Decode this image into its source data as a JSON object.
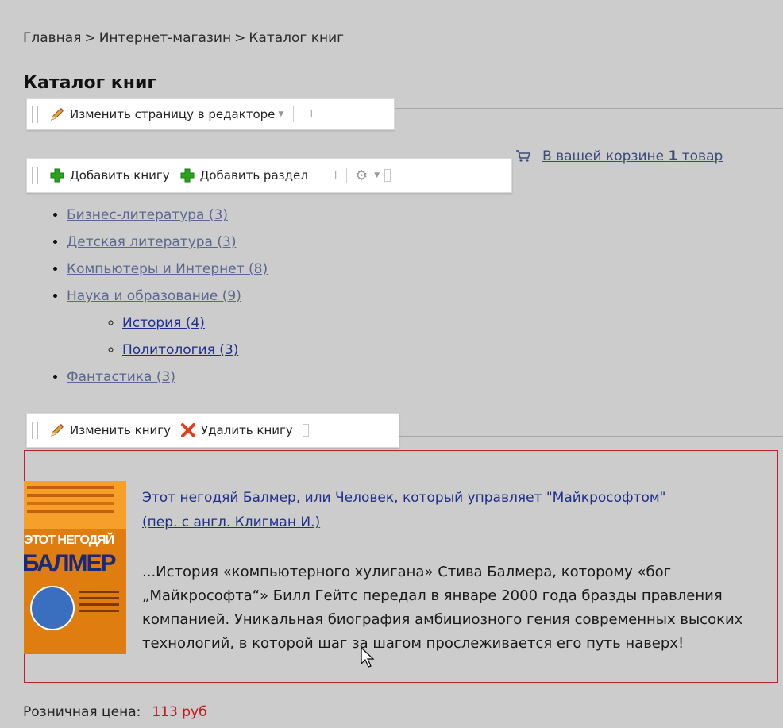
{
  "breadcrumb": {
    "items": [
      "Главная",
      "Интернет-магазин",
      "Каталог книг"
    ],
    "separator": ">"
  },
  "page_title": "Каталог книг",
  "edit_page_toolbar": {
    "edit_label": "Изменить страницу в редакторе"
  },
  "catalog_toolbar": {
    "add_book_label": "Добавить книгу",
    "add_section_label": "Добавить раздел"
  },
  "cart": {
    "prefix": "В вашей корзине",
    "count": "1",
    "suffix": "товар"
  },
  "categories": [
    {
      "label": "Бизнес-литература (3)"
    },
    {
      "label": "Детская литература (3)"
    },
    {
      "label": "Компьютеры и Интернет (8)"
    },
    {
      "label": "Наука и образование (9)",
      "children": [
        {
          "label": "История (4)"
        },
        {
          "label": "Политология (3)"
        }
      ]
    },
    {
      "label": "Фантастика (3)"
    }
  ],
  "book_toolbar": {
    "edit_label": "Изменить книгу",
    "delete_label": "Удалить книгу"
  },
  "book": {
    "cover_text_line1": "ЭТОТ НЕГОДЯЙ",
    "cover_text_line2": "БАЛМЕР",
    "title": "Этот негодяй Балмер, или Человек, который управляет \"Майкрософтом\" (пер. с англ. Клигман И.)",
    "description": "...История «компьютерного хулигана» Стива Балмера, которому «бог „Майкрософта“» Билл Гейтс передал в январе 2000 года бразды правления компанией. Уникальная биография амбициозного гения современных высоких технологий, в которой шаг за шагом прослеживается его путь наверх!",
    "price_label": "Розничная цена:",
    "price_value": "113 руб"
  },
  "colors": {
    "background": "#cccccc",
    "link": "#1f2f8a",
    "visited_link": "#5b6790",
    "price": "#c4141c",
    "box_border": "#c0202a",
    "add_icon": "#2aa31f",
    "delete_icon": "#e0401a"
  },
  "icons": {
    "edit": "pencil-icon",
    "add": "plus-icon",
    "delete": "cross-icon",
    "pin": "pin-icon",
    "settings": "gear-icon",
    "cart": "cart-icon"
  }
}
